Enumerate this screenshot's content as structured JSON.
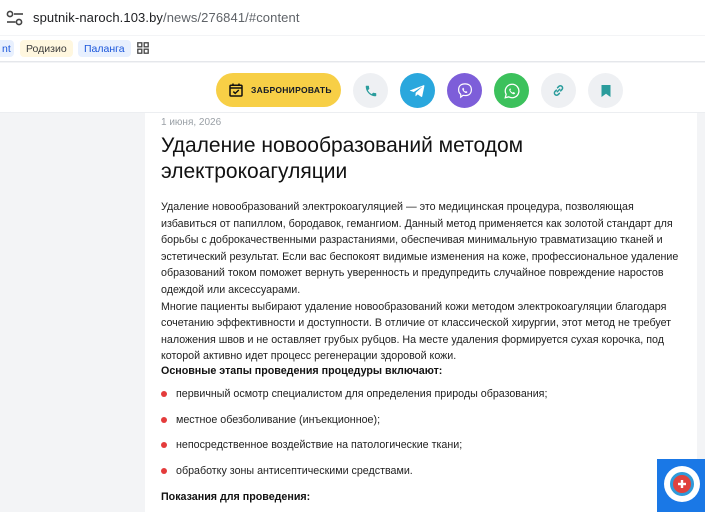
{
  "browser": {
    "url_host": "sputnik-naroch.103.by",
    "url_path": "/news/276841/#content"
  },
  "bookmarks": [
    {
      "label": "nt"
    },
    {
      "label": "Родизио"
    },
    {
      "label": "Паланга"
    }
  ],
  "header": {
    "book_label": "ЗАБРОНИРОВАТЬ",
    "accent": "#f7cf46",
    "telegram_color": "#2aa7dd",
    "viber_color": "#7d5ed9",
    "whatsapp_color": "#3cc15c"
  },
  "article": {
    "date": "1 июня, 2026",
    "title": "Удаление новообразований методом электрокоагуляции",
    "paragraphs": [
      "Удаление новообразований электрокоагуляцией — это медицинская процедура, позволяющая избавиться от папиллом, бородавок, гемангиом. Данный метод применяется как золотой стандарт для борьбы с доброкачественными разрастаниями, обеспечивая минимальную травматизацию тканей и эстетический результат. Если вас беспокоят видимые изменения на коже, профессиональное удаление образований током поможет вернуть уверенность и предупредить случайное повреждение наростов одеждой или аксессуарами.",
      "Многие пациенты выбирают удаление новообразований кожи методом электрокоагуляции благодаря сочетанию эффективности и доступности. В отличие от классической хирургии, этот метод не требует наложения швов и не оставляет грубых рубцов. На месте удаления формируется сухая корочка, под которой активно идет процесс регенерации здоровой кожи."
    ],
    "steps_heading": "Основные этапы проведения процедуры включают:",
    "steps": [
      "первичный осмотр специалистом для определения природы образования;",
      "местное обезболивание (инъекционное);",
      "непосредственное воздействие на патологические ткани;",
      "обработку зоны антисептическими средствами."
    ],
    "indications_heading": "Показания для проведения:"
  }
}
